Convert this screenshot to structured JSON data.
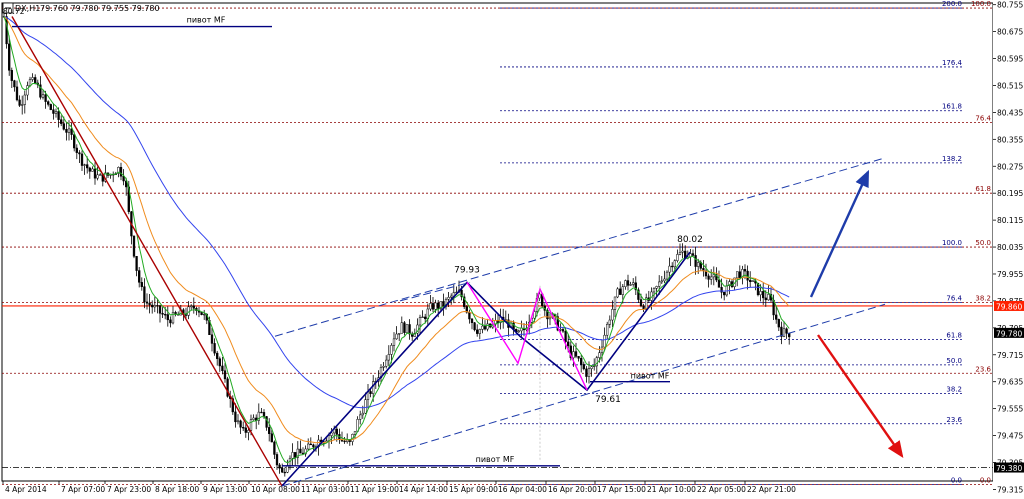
{
  "header": {
    "symbol": "DX,H1",
    "ohlc": "79.760 79.780 79.755 79.780",
    "corner_high": "80.72"
  },
  "colors": {
    "candle": "#000000",
    "ema_green": "#22aa22",
    "ema_orange": "#f08c1e",
    "ema_blue": "#3344ee",
    "red_line": "#aa0000",
    "fib_blue": "#000080",
    "fib_red": "#8b0000",
    "magenta": "#ff00ff",
    "arrow_blue": "#1e3caa",
    "arrow_red": "#e01010",
    "current_price_bg": "#000000",
    "level_price_bg": "#ff2000"
  },
  "annotations": {
    "pivot_top": "пивот MF",
    "pivot_mid": "пивот MF",
    "pivot_bottom": "пивот MF",
    "high_label": "79.93",
    "high2_label": "80.02",
    "low_label": "79.61"
  },
  "chart_data": {
    "type": "candlestick",
    "title": "DX,H1",
    "ylim": [
      79.34,
      80.76
    ],
    "y_ticks": [
      "80.755",
      "80.675",
      "80.595",
      "80.515",
      "80.435",
      "80.355",
      "80.275",
      "80.195",
      "80.115",
      "80.035",
      "79.955",
      "79.875",
      "79.795",
      "79.715",
      "79.635",
      "79.555",
      "79.475",
      "79.395",
      "79.315"
    ],
    "x_ticks": [
      "4 Apr 2014",
      "7 Apr 07:00",
      "7 Apr 23:00",
      "8 Apr 18:00",
      "9 Apr 13:00",
      "10 Apr 08:00",
      "11 Apr 03:00",
      "11 Apr 19:00",
      "14 Apr 14:00",
      "15 Apr 09:00",
      "16 Apr 04:00",
      "16 Apr 20:00",
      "17 Apr 15:00",
      "21 Apr 10:00",
      "22 Apr 05:00",
      "22 Apr 21:00"
    ],
    "current_price": "79.780",
    "highlight_price": "79.860",
    "pivot_price": "79.380",
    "price_path": [
      [
        0,
        80.62
      ],
      [
        4,
        80.72
      ],
      [
        10,
        80.55
      ],
      [
        20,
        80.45
      ],
      [
        28,
        80.53
      ],
      [
        36,
        80.52
      ],
      [
        44,
        80.47
      ],
      [
        52,
        80.44
      ],
      [
        62,
        80.4
      ],
      [
        72,
        80.36
      ],
      [
        80,
        80.3
      ],
      [
        90,
        80.26
      ],
      [
        100,
        80.24
      ],
      [
        110,
        80.25
      ],
      [
        118,
        80.27
      ],
      [
        125,
        80.24
      ],
      [
        130,
        80.1
      ],
      [
        136,
        79.98
      ],
      [
        140,
        79.92
      ],
      [
        146,
        79.87
      ],
      [
        152,
        79.86
      ],
      [
        160,
        79.84
      ],
      [
        168,
        79.82
      ],
      [
        176,
        79.83
      ],
      [
        186,
        79.84
      ],
      [
        196,
        79.86
      ],
      [
        204,
        79.83
      ],
      [
        212,
        79.76
      ],
      [
        220,
        79.68
      ],
      [
        228,
        79.6
      ],
      [
        236,
        79.52
      ],
      [
        244,
        79.48
      ],
      [
        252,
        79.52
      ],
      [
        260,
        79.54
      ],
      [
        268,
        79.5
      ],
      [
        276,
        79.4
      ],
      [
        282,
        79.36
      ],
      [
        290,
        79.42
      ],
      [
        300,
        79.42
      ],
      [
        310,
        79.44
      ],
      [
        318,
        79.46
      ],
      [
        326,
        79.47
      ],
      [
        334,
        79.49
      ],
      [
        342,
        79.46
      ],
      [
        350,
        79.45
      ],
      [
        358,
        79.52
      ],
      [
        366,
        79.58
      ],
      [
        376,
        79.64
      ],
      [
        386,
        79.71
      ],
      [
        394,
        79.77
      ],
      [
        402,
        79.8
      ],
      [
        412,
        79.78
      ],
      [
        422,
        79.82
      ],
      [
        432,
        79.86
      ],
      [
        442,
        79.86
      ],
      [
        452,
        79.89
      ],
      [
        460,
        79.9
      ],
      [
        468,
        79.84
      ],
      [
        476,
        79.79
      ],
      [
        484,
        79.79
      ],
      [
        492,
        79.8
      ],
      [
        500,
        79.82
      ],
      [
        508,
        79.81
      ],
      [
        516,
        79.77
      ],
      [
        524,
        79.79
      ],
      [
        532,
        79.84
      ],
      [
        540,
        79.89
      ],
      [
        546,
        79.84
      ],
      [
        554,
        79.82
      ],
      [
        562,
        79.78
      ],
      [
        570,
        79.72
      ],
      [
        578,
        79.7
      ],
      [
        586,
        79.66
      ],
      [
        594,
        79.68
      ],
      [
        602,
        79.75
      ],
      [
        610,
        79.83
      ],
      [
        618,
        79.9
      ],
      [
        626,
        79.93
      ],
      [
        634,
        79.92
      ],
      [
        642,
        79.86
      ],
      [
        650,
        79.88
      ],
      [
        658,
        79.92
      ],
      [
        666,
        79.96
      ],
      [
        674,
        80.0
      ],
      [
        682,
        80.02
      ],
      [
        690,
        80.01
      ],
      [
        698,
        79.98
      ],
      [
        706,
        79.96
      ],
      [
        714,
        79.94
      ],
      [
        722,
        79.9
      ],
      [
        730,
        79.92
      ],
      [
        738,
        79.96
      ],
      [
        746,
        79.95
      ],
      [
        754,
        79.92
      ],
      [
        762,
        79.89
      ],
      [
        770,
        79.88
      ],
      [
        776,
        79.82
      ],
      [
        782,
        79.78
      ],
      [
        790,
        79.78
      ]
    ],
    "fibonacci_levels": {
      "upper_right": [
        {
          "ratio": "200.0",
          "price": 80.745
        },
        {
          "ratio": "176.4",
          "price": 80.57
        },
        {
          "ratio": "161.8",
          "price": 80.44
        },
        {
          "ratio": "138.2",
          "price": 80.285
        },
        {
          "ratio": "100.0",
          "price": 80.035
        },
        {
          "ratio": "76.4",
          "price": 79.87
        },
        {
          "ratio": "61.8",
          "price": 79.76
        },
        {
          "ratio": "50.0",
          "price": 79.685
        },
        {
          "ratio": "38.2",
          "price": 79.6
        },
        {
          "ratio": "23.6",
          "price": 79.51
        },
        {
          "ratio": "0.0",
          "price": 79.33
        }
      ],
      "right_edge": [
        {
          "ratio": "100.0",
          "price": 80.745
        },
        {
          "ratio": "76.4",
          "price": 80.405
        },
        {
          "ratio": "61.8",
          "price": 80.195
        },
        {
          "ratio": "50.0",
          "price": 80.035
        },
        {
          "ratio": "38.2",
          "price": 79.87
        },
        {
          "ratio": "23.6",
          "price": 79.66
        },
        {
          "ratio": "0.0",
          "price": 79.33
        }
      ]
    }
  }
}
